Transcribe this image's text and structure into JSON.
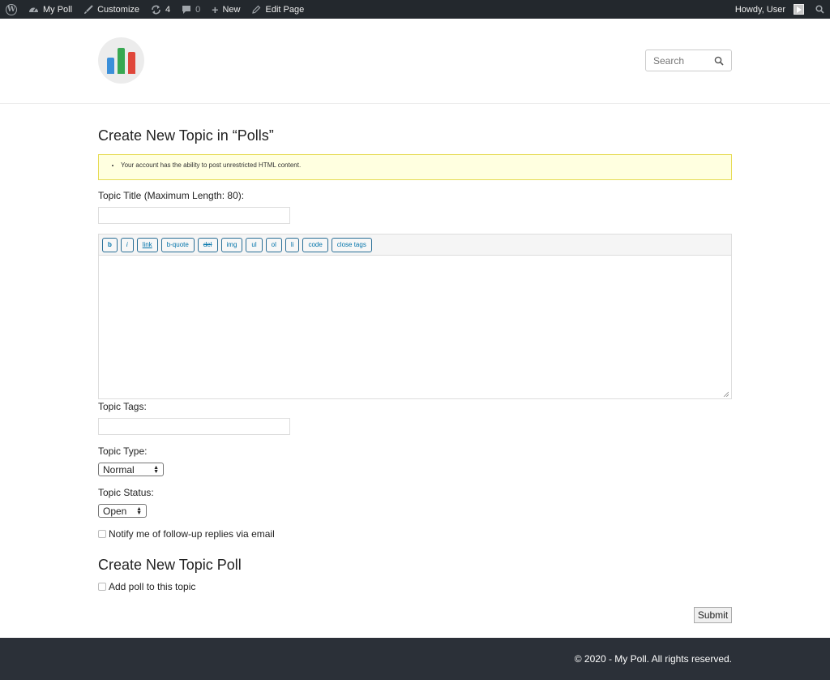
{
  "admin_bar": {
    "site_name": "My Poll",
    "customize": "Customize",
    "updates_count": "4",
    "comments_count": "0",
    "new": "New",
    "edit_page": "Edit Page",
    "howdy": "Howdy, User",
    "colors": {
      "background": "#23282d"
    }
  },
  "header": {
    "logo_icon": "bar-chart-logo",
    "logo_colors": [
      "#3b8fd9",
      "#38a852",
      "#e0473b"
    ],
    "search_placeholder": "Search"
  },
  "form": {
    "heading": "Create New Topic in “Polls”",
    "notice": "Your account has the ability to post unrestricted HTML content.",
    "title_label": "Topic Title (Maximum Length: 80):",
    "title_value": "",
    "quicktags": [
      "b",
      "i",
      "link",
      "b-quote",
      "del",
      "img",
      "ul",
      "ol",
      "li",
      "code",
      "close tags"
    ],
    "content_value": "",
    "tags_label": "Topic Tags:",
    "tags_value": "",
    "type_label": "Topic Type:",
    "type_selected": "Normal",
    "status_label": "Topic Status:",
    "status_selected": "Open",
    "notify_label": "Notify me of follow-up replies via email",
    "notify_checked": false
  },
  "poll": {
    "heading": "Create New Topic Poll",
    "add_poll_label": "Add poll to this topic",
    "add_poll_checked": false
  },
  "submit_label": "Submit",
  "footer": {
    "text": "© 2020 - My Poll. All rights reserved."
  }
}
